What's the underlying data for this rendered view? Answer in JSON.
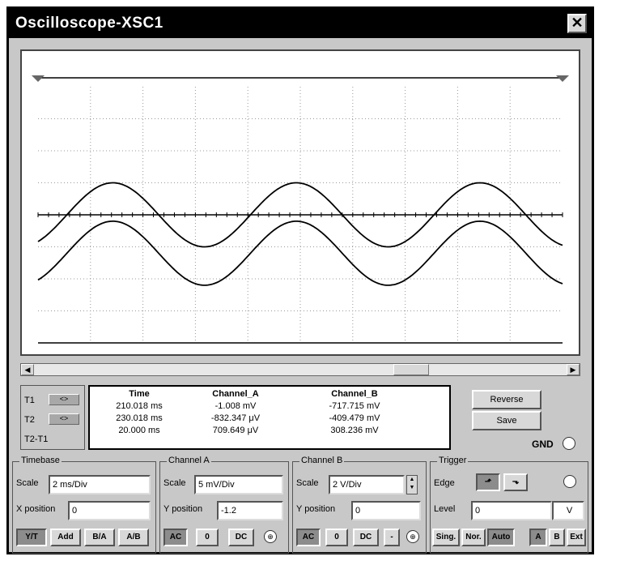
{
  "window": {
    "title": "Oscilloscope-XSC1"
  },
  "scope": {
    "channel_a": {
      "amplitude_div": 1.0,
      "offset_div": 0.0,
      "period_div": 3.5,
      "phase_div": 0.55
    },
    "channel_b": {
      "amplitude_div": 1.0,
      "offset_div": -1.2,
      "period_div": 3.5,
      "phase_div": 0.55
    },
    "grid": true
  },
  "cursors": {
    "t1_label": "T1",
    "t2_label": "T2",
    "t2t1_label": "T2-T1",
    "arrows_label": "<>"
  },
  "readout": {
    "headers": {
      "time": "Time",
      "channel_a": "Channel_A",
      "channel_b": "Channel_B"
    },
    "rows": [
      {
        "time": "210.018 ms",
        "channel_a": "-1.008 mV",
        "channel_b": "-717.715 mV"
      },
      {
        "time": "230.018 ms",
        "channel_a": "-832.347 μV",
        "channel_b": "-409.479 mV"
      },
      {
        "time": "20.000 ms",
        "channel_a": "709.649 μV",
        "channel_b": "308.236 mV"
      }
    ]
  },
  "buttons": {
    "reverse": "Reverse",
    "save": "Save",
    "gnd": "GND"
  },
  "timebase": {
    "title": "Timebase",
    "scale_label": "Scale",
    "scale_value": "2 ms/Div",
    "xpos_label": "X position",
    "xpos_value": "0",
    "modes": [
      "Y/T",
      "Add",
      "B/A",
      "A/B"
    ]
  },
  "channel_a_panel": {
    "title": "Channel A",
    "scale_label": "Scale",
    "scale_value": "5 mV/Div",
    "ypos_label": "Y position",
    "ypos_value": "-1.2",
    "coupling": [
      "AC",
      "0",
      "DC"
    ]
  },
  "channel_b_panel": {
    "title": "Channel B",
    "scale_label": "Scale",
    "scale_value": "2 V/Div",
    "ypos_label": "Y position",
    "ypos_value": "0",
    "coupling": [
      "AC",
      "0",
      "DC",
      "-"
    ]
  },
  "trigger": {
    "title": "Trigger",
    "edge_label": "Edge",
    "level_label": "Level",
    "level_value": "0",
    "level_unit": "V",
    "modes": [
      "Sing.",
      "Nor.",
      "Auto"
    ],
    "sources": [
      "A",
      "B",
      "Ext"
    ]
  }
}
